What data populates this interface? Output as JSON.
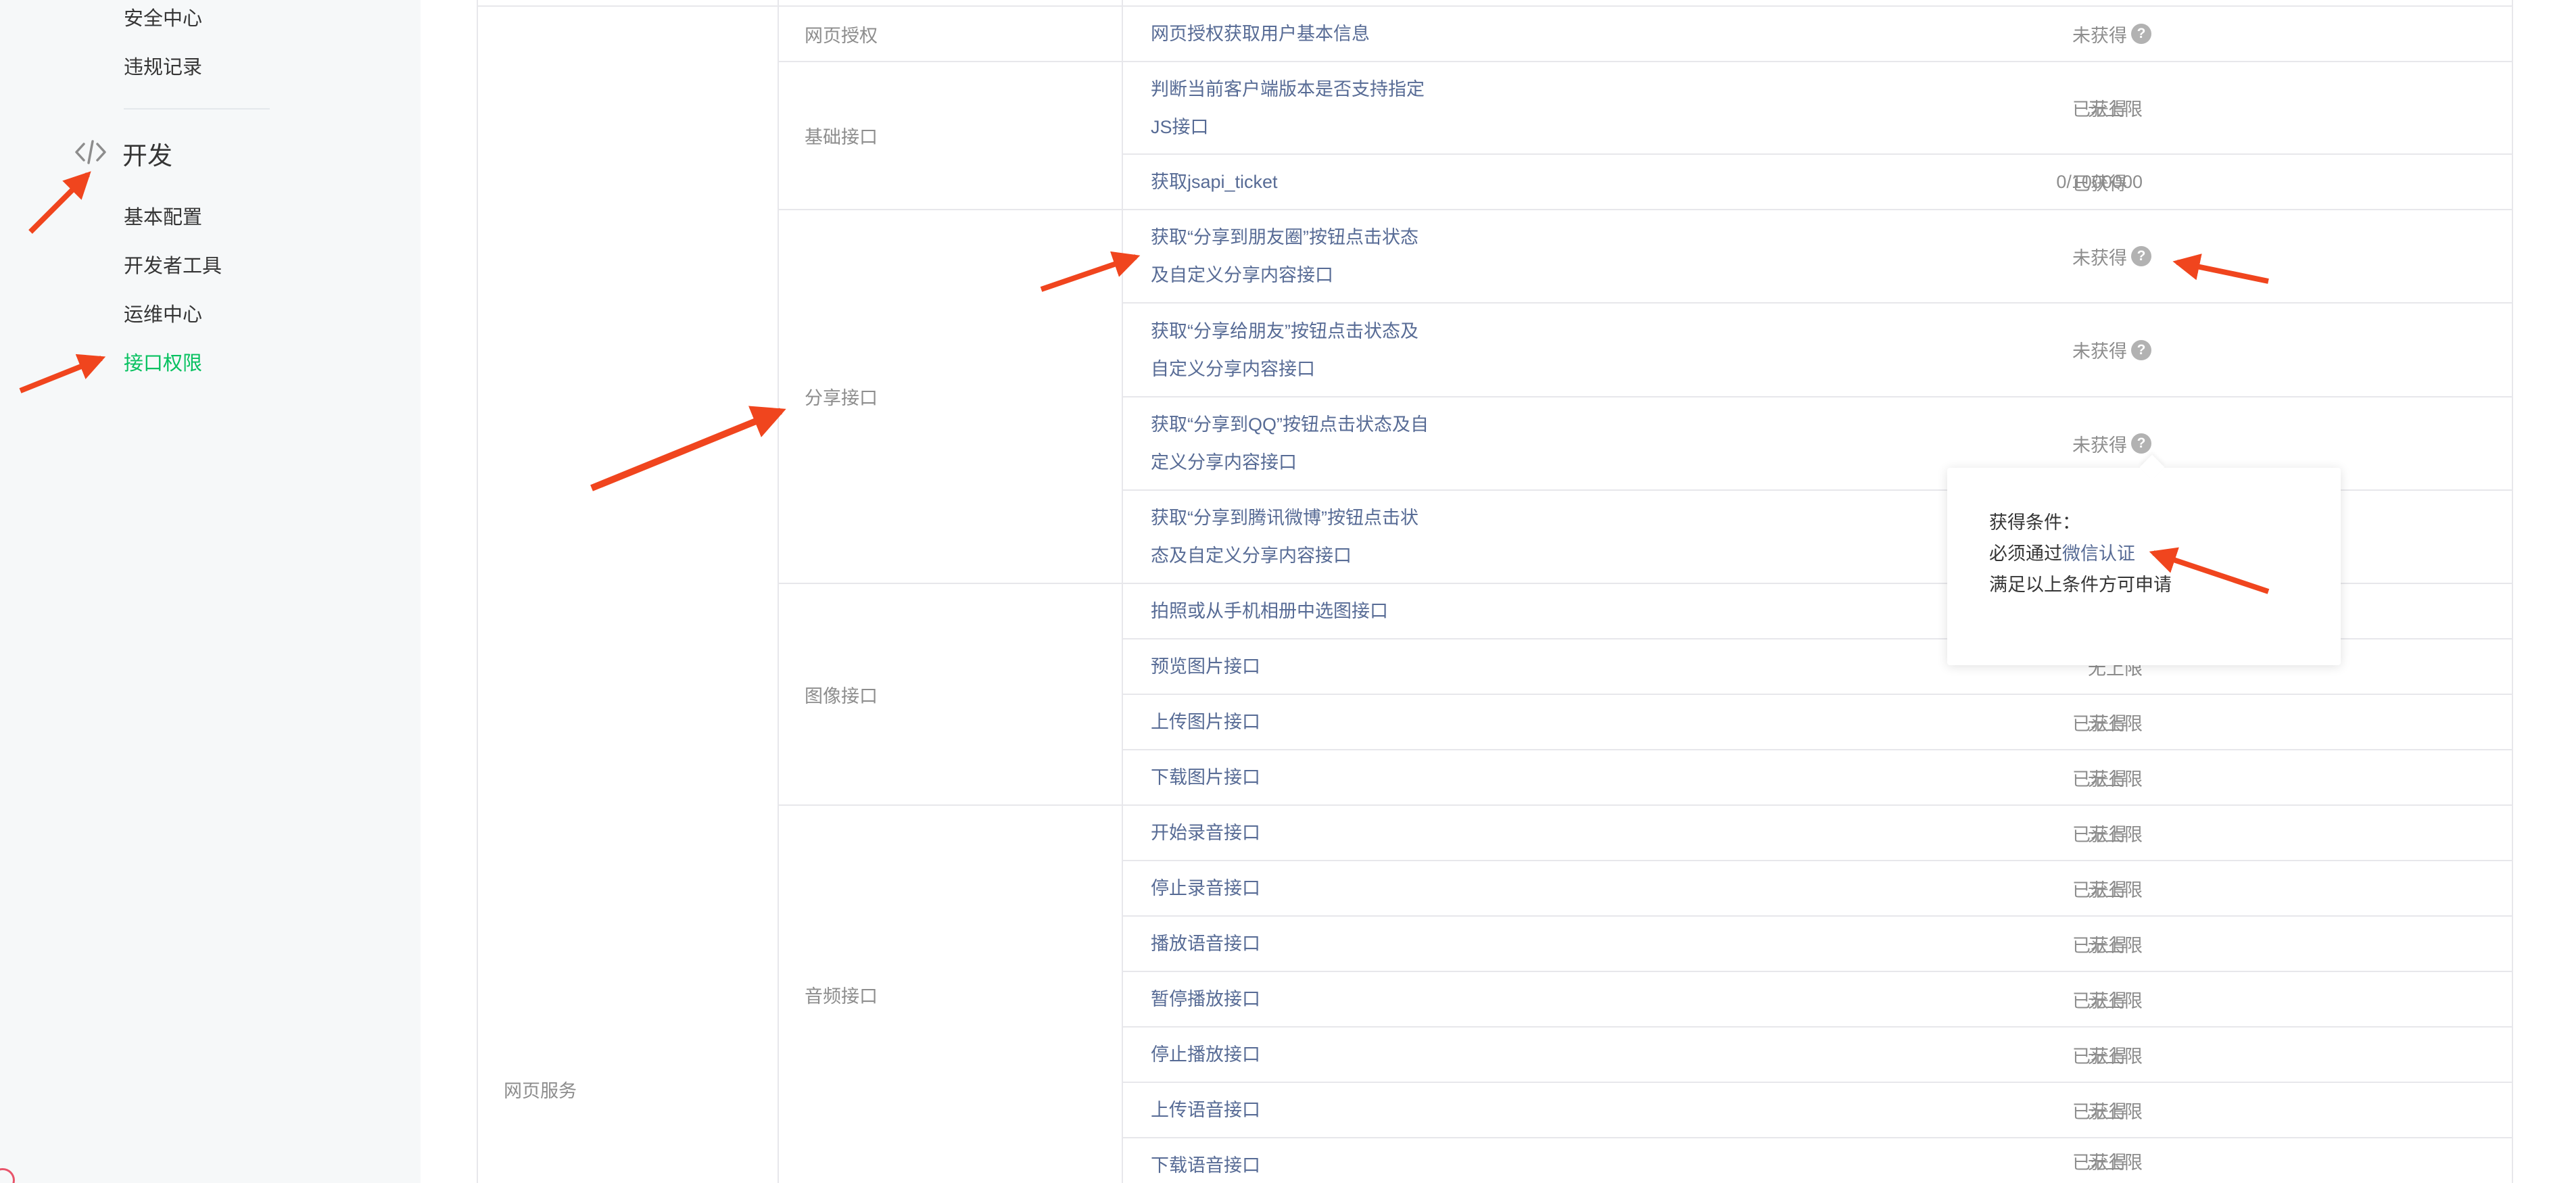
{
  "sidebar": {
    "items_top": [
      "安全中心",
      "违规记录"
    ],
    "group_label": "开发",
    "group_icon": "code-icon",
    "items_dev": [
      "基本配置",
      "开发者工具",
      "运维中心",
      "接口权限"
    ],
    "active_item": "接口权限",
    "active_color": "#07c160"
  },
  "table": {
    "service_category": "网页服务",
    "rows": [
      {
        "category": "网页授权",
        "api": "网页授权获取用户基本信息",
        "limit": "",
        "status": "未获得",
        "help": true
      },
      {
        "category": "基础接口",
        "api": "判断当前客户端版本是否支持指定JS接口",
        "limit": "无上限",
        "status": "已获得"
      },
      {
        "category": "",
        "api": "获取jsapi_ticket",
        "limit": "0/1000000",
        "status": "已获得"
      },
      {
        "category": "分享接口",
        "api": "获取“分享到朋友圈”按钮点击状态及自定义分享内容接口",
        "limit": "",
        "status": "未获得",
        "help": true
      },
      {
        "category": "",
        "api": "获取“分享给朋友”按钮点击状态及自定义分享内容接口",
        "limit": "",
        "status": "未获得",
        "help": true
      },
      {
        "category": "",
        "api": "获取“分享到QQ”按钮点击状态及自定义分享内容接口",
        "limit": "",
        "status": "未获得",
        "help": true
      },
      {
        "category": "",
        "api": "获取“分享到腾讯微博”按钮点击状态及自定义分享内容接口",
        "limit": "",
        "status": "",
        "help": false
      },
      {
        "category": "图像接口",
        "api": "拍照或从手机相册中选图接口",
        "limit": "",
        "status": ""
      },
      {
        "category": "",
        "api": "预览图片接口",
        "limit": "无上限",
        "status": "已获得"
      },
      {
        "category": "",
        "api": "上传图片接口",
        "limit": "无上限",
        "status": "已获得"
      },
      {
        "category": "",
        "api": "下载图片接口",
        "limit": "无上限",
        "status": "已获得"
      },
      {
        "category": "音频接口",
        "api": "开始录音接口",
        "limit": "无上限",
        "status": "已获得"
      },
      {
        "category": "",
        "api": "停止录音接口",
        "limit": "无上限",
        "status": "已获得"
      },
      {
        "category": "",
        "api": "播放语音接口",
        "limit": "无上限",
        "status": "已获得"
      },
      {
        "category": "",
        "api": "暂停播放接口",
        "limit": "无上限",
        "status": "已获得"
      },
      {
        "category": "",
        "api": "停止播放接口",
        "limit": "无上限",
        "status": "已获得"
      },
      {
        "category": "",
        "api": "上传语音接口",
        "limit": "无上限",
        "status": "已获得"
      },
      {
        "category": "",
        "api": "下载语音接口",
        "limit": "无上限",
        "status": "已获得"
      }
    ],
    "help_glyph": "?"
  },
  "tooltip": {
    "title": "获得条件：",
    "line1_prefix": "必须通过",
    "line1_link": "微信认证",
    "line2": "满足以上条件方可申请"
  },
  "colors": {
    "link": "#576b95",
    "muted": "#8d8d8d",
    "arrow": "#f0451e",
    "border": "#e7e7eb"
  }
}
